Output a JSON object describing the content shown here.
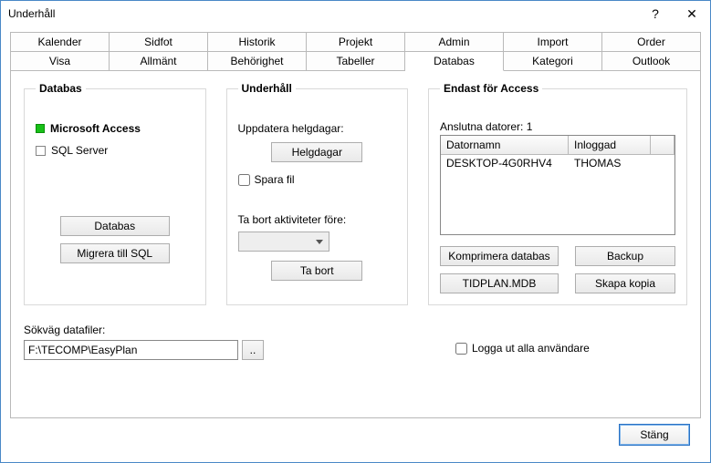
{
  "window": {
    "title": "Underhåll",
    "help": "?",
    "close": "✕"
  },
  "tabs_row1": [
    "Kalender",
    "Sidfot",
    "Historik",
    "Projekt",
    "Admin",
    "Import",
    "Order"
  ],
  "tabs_row2": [
    "Visa",
    "Allmänt",
    "Behörighet",
    "Tabeller",
    "Databas",
    "Kategori",
    "Outlook"
  ],
  "active_tab": "Databas",
  "group_db": {
    "legend": "Databas",
    "opt_access": "Microsoft Access",
    "opt_sql": "SQL Server",
    "btn_db": "Databas",
    "btn_migrate": "Migrera till SQL"
  },
  "group_maint": {
    "legend": "Underhåll",
    "holidays_label": "Uppdatera helgdagar:",
    "btn_holidays": "Helgdagar",
    "chk_savefile": "Spara fil",
    "remove_label": "Ta bort aktiviteter före:",
    "btn_remove": "Ta bort"
  },
  "group_access": {
    "legend": "Endast för Access",
    "connected_label": "Anslutna datorer: 1",
    "col_computer": "Datornamn",
    "col_user": "Inloggad",
    "rows": [
      {
        "computer": "DESKTOP-4G0RHV4",
        "user": "THOMAS"
      }
    ],
    "btn_compact": "Komprimera databas",
    "btn_backup": "Backup",
    "btn_tidplan": "TIDPLAN.MDB",
    "btn_copy": "Skapa kopia"
  },
  "path": {
    "label": "Sökväg datafiler:",
    "value": "F:\\TECOMP\\EasyPlan",
    "browse": ".."
  },
  "chk_logout": "Logga ut alla användare",
  "btn_close": "Stäng"
}
